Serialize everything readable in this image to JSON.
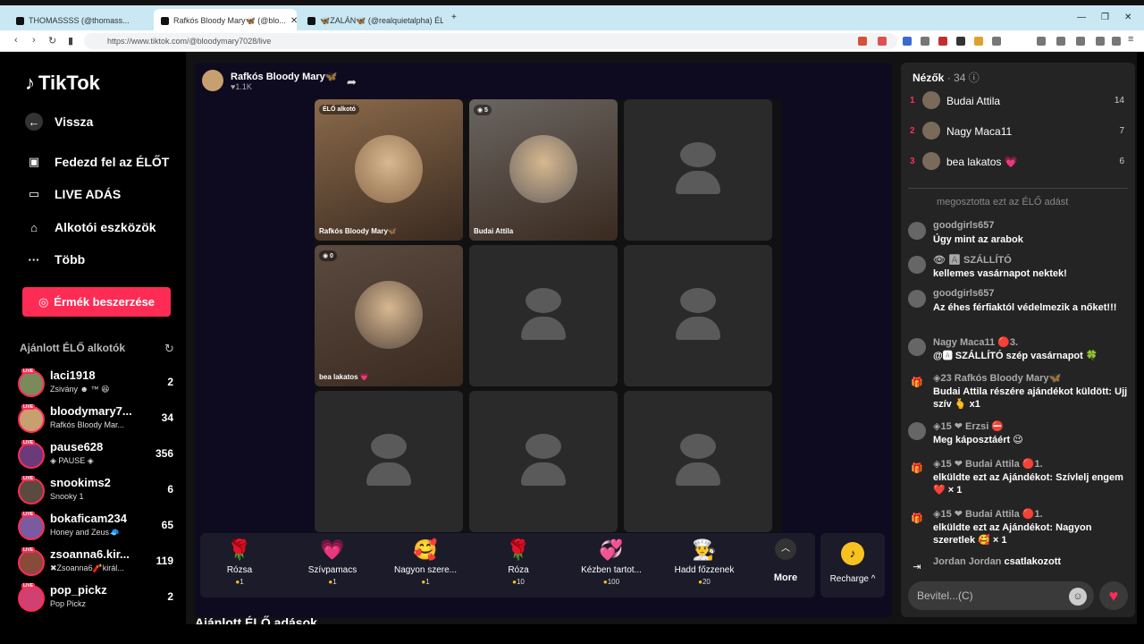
{
  "browser": {
    "tabs": [
      {
        "title": "THOMASSSS (@thomass..."
      },
      {
        "title": "Rafkós Bloody Mary🦋 (@blo..."
      },
      {
        "title": "🦋ZALÁN🦋 (@realquietalpha) ÉLŐ"
      }
    ],
    "url": "https://www.tiktok.com/@bloodymary7028/live"
  },
  "sidebar": {
    "logo": "TikTok",
    "nav": [
      {
        "label": "Vissza",
        "icon": "back-arrow-icon"
      },
      {
        "label": "Fedezd fel az ÉLŐT",
        "icon": "live-tv-icon"
      },
      {
        "label": "LIVE ADÁS",
        "icon": "camera-icon"
      },
      {
        "label": "Alkotói eszközök",
        "icon": "creator-tools-icon"
      },
      {
        "label": "Több",
        "icon": "more-icon"
      }
    ],
    "coins_button": "Érmék beszerzése",
    "recommended_heading": "Ajánlott ÉLŐ alkotók",
    "live_badge": "LIVE",
    "creators": [
      {
        "name": "laci1918",
        "sub": "Zsivány ☻ ™ 😆",
        "count": "2"
      },
      {
        "name": "bloodymary7...",
        "sub": "Rafkós Bloody Mar...",
        "count": "34"
      },
      {
        "name": "pause628",
        "sub": "◈ PAUSE ◈",
        "count": "356"
      },
      {
        "name": "snookims2",
        "sub": "Snooky 1",
        "count": "6"
      },
      {
        "name": "bokaficam234",
        "sub": "Honey and Zeus🧢",
        "count": "65"
      },
      {
        "name": "zsoanna6.kir...",
        "sub": "✖Zsoanna6🧨királ...",
        "count": "119"
      },
      {
        "name": "pop_pickz",
        "sub": "Pop Pickz",
        "count": "2"
      }
    ]
  },
  "stage": {
    "host_name": "Rafkós Bloody Mary🦋",
    "host_likes": "♥1.1K",
    "cells": [
      {
        "label": "Rafkós Bloody Mary🦋",
        "badge": "ÉLŐ alkotó",
        "color": "#8a6a4a"
      },
      {
        "label": "Budai Attila",
        "badge": "◉ 5",
        "color": "#6a6560"
      },
      {
        "label": "",
        "badge": "",
        "color": ""
      },
      {
        "label": "bea lakatos 💗",
        "badge": "◉ 0",
        "color": "#5a4a40"
      },
      {
        "label": "",
        "badge": "",
        "color": ""
      },
      {
        "label": "",
        "badge": "",
        "color": ""
      },
      {
        "label": "",
        "badge": "",
        "color": ""
      },
      {
        "label": "",
        "badge": "",
        "color": ""
      },
      {
        "label": "",
        "badge": "",
        "color": ""
      }
    ],
    "gifts": [
      {
        "name": "Rózsa",
        "price": "1",
        "icon": "🌹"
      },
      {
        "name": "Szívpamacs",
        "price": "1",
        "icon": "💗"
      },
      {
        "name": "Nagyon szere...",
        "price": "1",
        "icon": "🥰"
      },
      {
        "name": "Róza",
        "price": "10",
        "icon": "🌹"
      },
      {
        "name": "Kézben tartot...",
        "price": "100",
        "icon": "💞"
      },
      {
        "name": "Hadd főzzenek",
        "price": "20",
        "icon": "👨‍🍳"
      }
    ],
    "more_label": "More",
    "recharge_label": "Recharge ^",
    "bottom_heading": "Ajánlott ÉLŐ adások"
  },
  "chat": {
    "viewers_label": "Nézők",
    "viewers_count": "· 34",
    "viewers": [
      {
        "rank": "1",
        "name": "Budai Attila",
        "count": "14"
      },
      {
        "rank": "2",
        "name": "Nagy Maca11",
        "count": "7"
      },
      {
        "rank": "3",
        "name": "bea lakatos 💗",
        "count": "6"
      }
    ],
    "shared_text": "megosztotta ezt az ÉLŐ adást",
    "messages": [
      {
        "who": "goodgirls657",
        "text": "Úgy mint az arabok"
      },
      {
        "who": "👁 🅰 SZÁLLÍTÓ",
        "text": "kellemes vasárnapot nektek!"
      },
      {
        "who": "goodgirls657",
        "text": "Az éhes férfiaktól védelmezik a nőket!!!"
      },
      {
        "who": "Nagy Maca11 🔴3.",
        "text": "@🅰 SZÁLLÍTÓ szép vasárnapot 🍀"
      },
      {
        "who": "◈23 Rafkós Bloody Mary🦋",
        "text": "Budai Attila részére ajándékot küldött: Ujj szív 🫰 x1"
      },
      {
        "who": "◈15 ❤ Erzsi ⛔",
        "text": "Meg káposztáért 😉"
      },
      {
        "who": "◈15 ❤ Budai Attila 🔴1.",
        "text": "elküldte ezt az Ajándékot: Szívlelj engem ❤️ × 1"
      },
      {
        "who": "◈15 ❤ Budai Attila 🔴1.",
        "text": "elküldte ezt az Ajándékot: Nagyon szeretlek 🥰 × 1"
      },
      {
        "who": "Jordan Jordan",
        "text": "csatlakozott"
      }
    ],
    "input_placeholder": "Bevitel...(C)"
  }
}
